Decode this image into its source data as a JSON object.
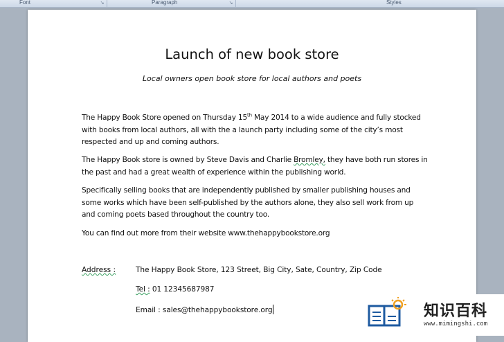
{
  "ribbon": {
    "groups": [
      {
        "label": "Font"
      },
      {
        "label": "Paragraph"
      },
      {
        "label": "Styles"
      }
    ],
    "launcher_glyph": "↘"
  },
  "document": {
    "title": "Launch of new book store",
    "subtitle": "Local owners open book store for local authors and poets",
    "p1": {
      "a": "The Happy Book Store opened on Thursday 15",
      "sup": "th",
      "b": "  May 2014  to a wide audience and fully stocked with books from local authors, all with the a launch party including some of the city’s most respected and up and coming authors."
    },
    "p2": {
      "a": "The Happy Book store is owned by Steve Davis and Charlie ",
      "flagged": "Bromley,",
      "b": " they have both run stores in the past and had a great wealth of experience within the publishing world."
    },
    "p3": "Specifically selling books that are independently published by smaller publishing houses and some works which have been self-published by the authors alone, they also sell work from up and coming poets based throughout the country too.",
    "p4": "You can find out more from their website www.thehappybookstore.org",
    "address": {
      "label": "Address :",
      "line": "The Happy Book Store, 123  Street, Big City, Sate, Country, Zip Code",
      "tel_label": "Tel :",
      "tel_value": " 01  12345687987",
      "email": "Email : sales@thehappybookstore.org"
    }
  },
  "watermark": {
    "text": "知识百科",
    "url": "www.mimingshi.com",
    "icon": "book-lightbulb-icon",
    "color": "#1e5aa0"
  }
}
